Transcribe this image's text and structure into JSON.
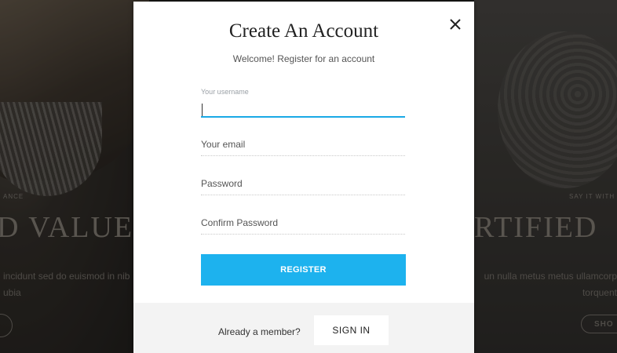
{
  "background": {
    "left_kicker": "ANCE",
    "right_kicker": "SAY IT WITH",
    "left_headline": "D VALUE",
    "right_headline": "RTIFIED",
    "left_text_line1": "incidunt sed do euismod in nib",
    "left_text_line2": "ubia",
    "right_text_line1": "un nulla metus metus ullamcorp",
    "right_text_line2": "torquent",
    "shop_button": "SHO"
  },
  "modal": {
    "title": "Create An Account",
    "subtitle": "Welcome! Register for an account",
    "close_icon": "close-icon",
    "fields": {
      "username": {
        "label": "Your username",
        "value": "",
        "active": true
      },
      "email": {
        "placeholder": "Your email"
      },
      "password": {
        "placeholder": "Password"
      },
      "confirm_password": {
        "placeholder": "Confirm Password"
      }
    },
    "register_button": "REGISTER",
    "footer": {
      "prompt": "Already a member?",
      "signin_button": "SIGN IN"
    }
  },
  "colors": {
    "accent": "#1db2ee",
    "active_underline": "#1aa9e6",
    "footer_bg": "#f3f3f3",
    "overlay": "rgba(0,0,0,0.45)"
  }
}
